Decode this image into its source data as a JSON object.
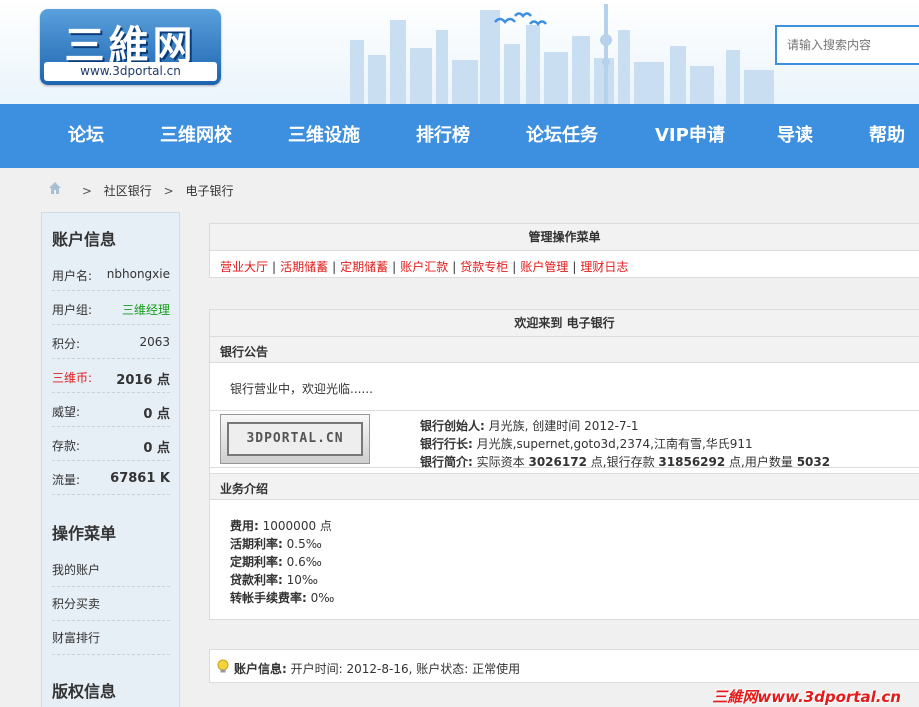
{
  "header": {
    "logo_text": "三維网",
    "logo_url": "www.3dportal.cn",
    "search_placeholder": "请输入搜索内容"
  },
  "nav": {
    "items": [
      "论坛",
      "三维网校",
      "三维设施",
      "排行榜",
      "论坛任务",
      "VIP申请",
      "导读",
      "帮助"
    ]
  },
  "breadcrumb": {
    "sep": ">",
    "items": [
      "社区银行",
      "电子银行"
    ]
  },
  "sidebar": {
    "account_title": "账户信息",
    "rows": [
      {
        "label": "用户名:",
        "value": "nbhongxie"
      },
      {
        "label": "用户组:",
        "value": "三维经理"
      },
      {
        "label": "积分:",
        "value": "2063"
      },
      {
        "label": "三维币:",
        "value": "2016 点"
      },
      {
        "label": "威望:",
        "value": "0 点"
      },
      {
        "label": "存款:",
        "value": "0 点"
      },
      {
        "label": "流量:",
        "value": "67861 K"
      }
    ],
    "menu_title": "操作菜单",
    "menu_items": [
      "我的账户",
      "积分买卖",
      "财富排行"
    ],
    "copyright_title": "版权信息"
  },
  "mgmt_menu": {
    "title": "管理操作菜单",
    "links": [
      "营业大厅",
      "活期储蓄",
      "定期储蓄",
      "账户汇款",
      "贷款专柜",
      "账户管理",
      "理财日志"
    ]
  },
  "bank": {
    "welcome": "欢迎来到 电子银行",
    "notice_title": "银行公告",
    "notice_text": "银行营业中，欢迎光临......",
    "logo_text": "3DPORTAL.CN",
    "founder_label": "银行创始人:",
    "founder_value": "月光族, 创建时间 2012-7-1",
    "president_label": "银行行长:",
    "president_value": "月光族,supernet,goto3d,2374,江南有雪,华氏911",
    "intro_label": "银行简介:",
    "intro_p1": "实际资本",
    "capital": "3026172",
    "intro_p2": "点,银行存款",
    "deposits": "31856292",
    "intro_p3": "点,用户数量",
    "users": "5032",
    "business_title": "业务介绍",
    "business": [
      {
        "label": "费用:",
        "value": "1000000 点"
      },
      {
        "label": "活期利率:",
        "value": "0.5‰"
      },
      {
        "label": "定期利率:",
        "value": "0.6‰"
      },
      {
        "label": "贷款利率:",
        "value": "10‰"
      },
      {
        "label": "转帐手续费率:",
        "value": "0‰"
      }
    ]
  },
  "status": {
    "label": "账户信息:",
    "text": "开户时间: 2012-8-16, 账户状态: 正常使用"
  },
  "watermark": "三維网www.3dportal.cn",
  "colors": {
    "nav_bg": "#3d8fe0",
    "link_red": "#e31b1b",
    "group_green": "#169c1d"
  }
}
